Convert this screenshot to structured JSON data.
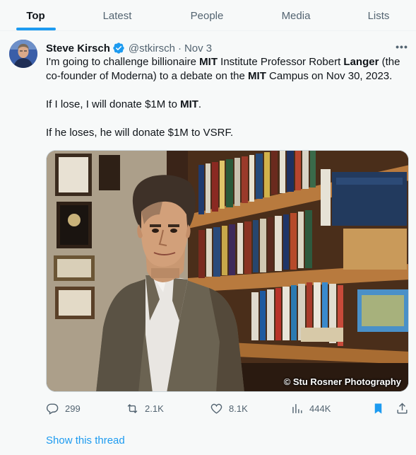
{
  "tabs": [
    {
      "label": "Top",
      "active": true
    },
    {
      "label": "Latest",
      "active": false
    },
    {
      "label": "People",
      "active": false
    },
    {
      "label": "Media",
      "active": false
    },
    {
      "label": "Lists",
      "active": false
    }
  ],
  "tweet": {
    "author_name": "Steve Kirsch",
    "handle": "@stkirsch",
    "separator": "·",
    "date": "Nov 3",
    "verified": true,
    "more_icon": "more-icon",
    "paragraph1": {
      "t1": "I'm going to challenge billionaire ",
      "b1": "MIT",
      "t2": " Institute Professor Robert ",
      "b2": "Langer",
      "t3": " (the co-founder of Moderna) to a debate on the ",
      "b3": "MIT",
      "t4": " Campus on Nov 30, 2023."
    },
    "paragraph2": {
      "t1": "If I lose, I will donate $1M to ",
      "b1": "MIT",
      "t2": "."
    },
    "paragraph3": "If he loses, he will donate $1M to VSRF.",
    "photo_credit": "© Stu Rosner Photography",
    "actions": {
      "replies": "299",
      "reposts": "2.1K",
      "likes": "8.1K",
      "views": "444K"
    },
    "show_thread": "Show this thread"
  },
  "colors": {
    "accent": "#1d9bf0",
    "text": "#0f1419",
    "secondary": "#536471",
    "background": "#f7f9f9"
  }
}
